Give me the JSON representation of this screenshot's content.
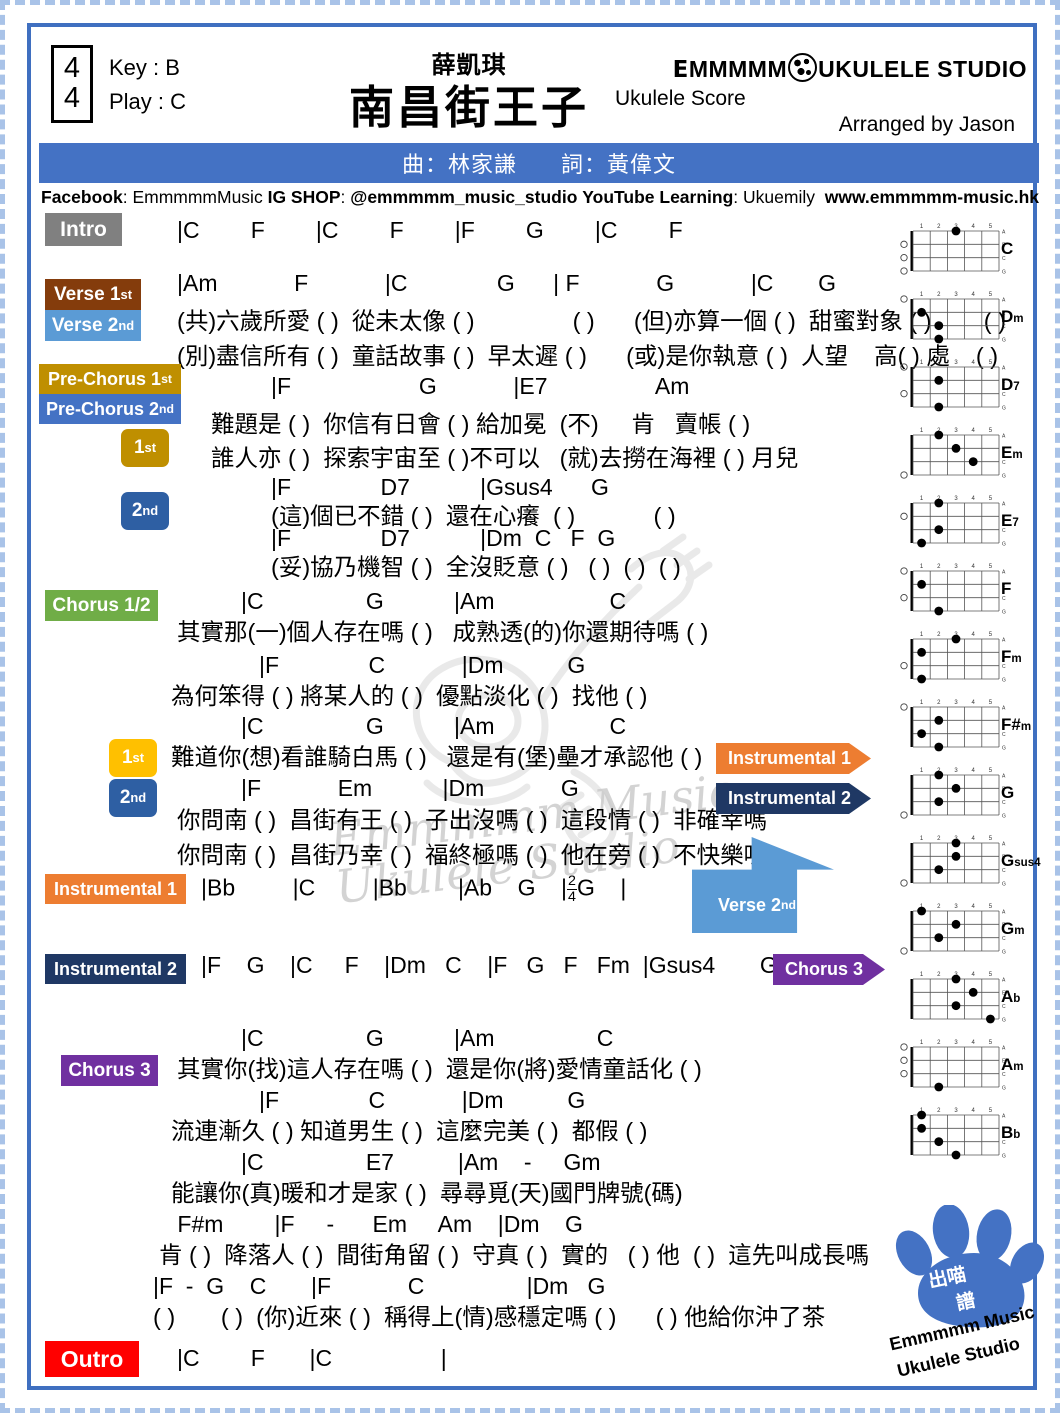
{
  "header": {
    "time_signature_top": "4",
    "time_signature_bottom": "4",
    "key_line": "Key : B",
    "play_line": "Play : C",
    "artist": "薛凱琪",
    "title": "南昌街王子",
    "brand_name_1": "E",
    "brand_name_2": "MMMMM",
    "brand_name_3": "UKULELE STUDIO",
    "score_type": "Ukulele Score",
    "arranged_by": "Arranged by Jason",
    "composer": "曲：林家謙",
    "lyricist": "詞：黃偉文",
    "socials_facebook_label": "Facebook",
    "socials_facebook_value": "EmmmmmMusic",
    "socials_ig_label": "IG SHOP",
    "socials_ig_value": "@emmmmm_music_studio",
    "socials_yt_label": "YouTube Learning",
    "socials_yt_value": "Ukuemily",
    "socials_site": "www.emmmmm-music.hk"
  },
  "labels": {
    "intro": "Intro",
    "verse1": "Verse 1",
    "verse1_sup": "st",
    "verse2": "Verse 2",
    "verse2_sup": "nd",
    "prechorus1": "Pre-Chorus 1",
    "prechorus1_sup": "st",
    "prechorus2": "Pre-Chorus 2",
    "prechorus2_sup": "nd",
    "ending1": "1",
    "ending1_sup": "st",
    "ending2": "2",
    "ending2_sup": "nd",
    "chorus12": "Chorus 1/2",
    "instrumental1": "Instrumental 1",
    "instrumental2": "Instrumental 2",
    "chorus3": "Chorus 3",
    "outro": "Outro",
    "verse2_arrow": "Verse 2",
    "verse2_arrow_sup": "nd"
  },
  "sections": {
    "intro": {
      "chords": "|C        F        |C        F        |F        G        |C        F"
    },
    "verse": {
      "chords": "|Am            F            |C              G      | F            G            |C       G",
      "lyric1": "(共)六歲所愛 ( )  從未太像 ( )               ( )      (但)亦算一個 ( )  甜蜜對象 ( )        ( )",
      "lyric2": "(別)盡信所有 ( )  童話故事 ( )  早太遲 ( )      (或)是你執意 ( )  人望    高( ) 處    ( )"
    },
    "prechorus": {
      "chords": "|F                    G            |E7                 Am",
      "lyric1": "難題是 ( )  你信有日會 ( ) 給加冕  (不)     肯   賣帳 ( )",
      "lyric2": "誰人亦 ( )  探索宇宙至 ( )不可以   (就)去撈在海裡 ( ) 月兒",
      "ending1_chords": "|F              D7           |Gsus4      G",
      "ending1_lyric": "(這)個已不錯 ( )  還在心癢  ( )            ( )",
      "ending2_chords": "|F              D7           |Dm  C   F  G",
      "ending2_lyric": "(妥)協乃機智 ( )  全沒貶意 ( )   ( )  ( )  ( )"
    },
    "chorus12": {
      "line1_chords": "|C                G           |Am                  C",
      "line1_lyric": "其實那(一)個人存在嗎 ( )   成熟透(的)你還期待嗎 ( )",
      "line2_chords": "|F              C            |Dm          G",
      "line2_lyric": "為何笨得 ( ) 將某人的 ( )  優點淡化 ( )  找他 ( )",
      "line3_chords": "|C                G           |Am                  C",
      "line3_lyric": "難道你(想)看誰騎白馬 ( )   還是有(堡)壘才承認他 ( )",
      "line4_chords": "|F            Em           |Dm            G",
      "line4_lyric1": "你問南 ( )  昌街有王 ( )  子出沒嗎 ( )  這段情 ( )  非確幸嗎",
      "line4_lyric2": "你問南 ( )  昌街乃幸 ( )  福終極嗎 ( )  他在旁 ( )  不快樂嗎"
    },
    "instrumental1": {
      "chords_a": "|Bb         |C         |Bb        |Ab    G    |",
      "chords_b": "G    |",
      "frac_num": "2",
      "frac_den": "4"
    },
    "instrumental2": {
      "chords": "|F    G    |C     F    |Dm   C    |F   G   F   Fm  |Gsus4       G"
    },
    "chorus3": {
      "line1_chords": "|C                G           |Am                C",
      "line1_lyric": "其實你(找)這人存在嗎 ( )  還是你(將)愛情童話化 ( )",
      "line2_chords": "|F              C            |Dm          G",
      "line2_lyric": "流連漸久 ( ) 知道男生 ( )  這麼完美 ( )  都假 ( )",
      "line3_chords": "|C                E7          |Am    -     Gm",
      "line3_lyric": "能讓你(真)暖和才是家 ( )  尋尋覓(天)國門牌號(碼)",
      "line4_chords": " F#m        |F     -      Em     Am    |Dm    G",
      "line4_lyric": "肯 ( )  降落人 ( )  間街角留 ( )  守真 ( )  實的   ( ) 他  ( )  這先叫成長嗎",
      "line5_chords": "|F  -  G    C       |F            C                |Dm   G",
      "line5_lyric": "( )       ( )  (你)近來 ( )  稱得上(情)感穩定嗎 ( )      ( ) 他給你沖了茶"
    },
    "outro": {
      "chords": "|C        F       |C                 |"
    }
  },
  "chord_diagrams": [
    {
      "name": "C",
      "sub": "",
      "open": [
        1,
        2,
        3
      ],
      "dots": [
        {
          "s": 0,
          "f": 3
        }
      ]
    },
    {
      "name": "D",
      "sub": "m",
      "open": [
        0
      ],
      "dots": [
        {
          "s": 1,
          "f": 1
        },
        {
          "s": 2,
          "f": 2
        },
        {
          "s": 3,
          "f": 2
        }
      ]
    },
    {
      "name": "D",
      "sub": "7",
      "open": [
        0,
        2
      ],
      "dots": [
        {
          "s": 1,
          "f": 2
        },
        {
          "s": 3,
          "f": 2
        }
      ]
    },
    {
      "name": "E",
      "sub": "m",
      "open": [
        3
      ],
      "dots": [
        {
          "s": 0,
          "f": 2
        },
        {
          "s": 1,
          "f": 3
        },
        {
          "s": 2,
          "f": 4
        }
      ]
    },
    {
      "name": "E",
      "sub": "7",
      "open": [
        1
      ],
      "dots": [
        {
          "s": 0,
          "f": 2
        },
        {
          "s": 2,
          "f": 2
        },
        {
          "s": 3,
          "f": 1
        }
      ]
    },
    {
      "name": "F",
      "sub": "",
      "open": [
        0,
        2
      ],
      "dots": [
        {
          "s": 1,
          "f": 1
        },
        {
          "s": 3,
          "f": 2
        }
      ]
    },
    {
      "name": "F",
      "sub": "m",
      "open": [
        2
      ],
      "dots": [
        {
          "s": 0,
          "f": 3
        },
        {
          "s": 1,
          "f": 1
        },
        {
          "s": 3,
          "f": 1
        }
      ]
    },
    {
      "name": "F#",
      "sub": "m",
      "open": [
        0
      ],
      "dots": [
        {
          "s": 1,
          "f": 2
        },
        {
          "s": 2,
          "f": 1
        },
        {
          "s": 3,
          "f": 2
        }
      ]
    },
    {
      "name": "G",
      "sub": "",
      "open": [
        3
      ],
      "dots": [
        {
          "s": 0,
          "f": 2
        },
        {
          "s": 1,
          "f": 3
        },
        {
          "s": 2,
          "f": 2
        }
      ]
    },
    {
      "name": "G",
      "sub": "sus4",
      "open": [
        3
      ],
      "dots": [
        {
          "s": 0,
          "f": 3
        },
        {
          "s": 1,
          "f": 3
        },
        {
          "s": 2,
          "f": 2
        }
      ]
    },
    {
      "name": "G",
      "sub": "m",
      "open": [
        3
      ],
      "dots": [
        {
          "s": 0,
          "f": 1
        },
        {
          "s": 1,
          "f": 3
        },
        {
          "s": 2,
          "f": 2
        }
      ]
    },
    {
      "name": "A",
      "sub": "b",
      "open": [],
      "dots": [
        {
          "s": 0,
          "f": 3
        },
        {
          "s": 1,
          "f": 4
        },
        {
          "s": 2,
          "f": 3
        },
        {
          "s": 3,
          "f": 5
        }
      ]
    },
    {
      "name": "A",
      "sub": "m",
      "open": [
        0,
        1,
        2
      ],
      "dots": [
        {
          "s": 3,
          "f": 2
        }
      ]
    },
    {
      "name": "B",
      "sub": "b",
      "open": [],
      "dots": [
        {
          "s": 0,
          "f": 1
        },
        {
          "s": 1,
          "f": 1
        },
        {
          "s": 2,
          "f": 2
        },
        {
          "s": 3,
          "f": 3
        }
      ]
    }
  ],
  "string_labels": [
    "A",
    "E",
    "C",
    "G"
  ],
  "fret_numbers": [
    "1",
    "2",
    "3",
    "4",
    "5"
  ],
  "watermark": {
    "text_line1": "Emmmmm Music",
    "text_line2": "Ukulele Studio"
  },
  "paw_logo": {
    "cn_top": "出喵",
    "cn_bottom": "譜",
    "line1": "Emmmmm Music",
    "line2": "Ukulele Studio"
  },
  "colors": {
    "frame_blue": "#3f6fc0",
    "bar_blue": "#4472c4",
    "intro_gray": "#808080",
    "verse1_brown": "#843c0c",
    "verse2_blue": "#5b9bd5",
    "prechorus1_gold": "#bf8f00",
    "prechorus2_blue": "#4472c4",
    "chorus12_green": "#70ad47",
    "instrumental1_orange": "#ed7d31",
    "instrumental2_navy": "#1f3864",
    "chorus3_purple": "#7030a0",
    "outro_red": "#ff0000",
    "paw_blue": "#4472c4"
  }
}
